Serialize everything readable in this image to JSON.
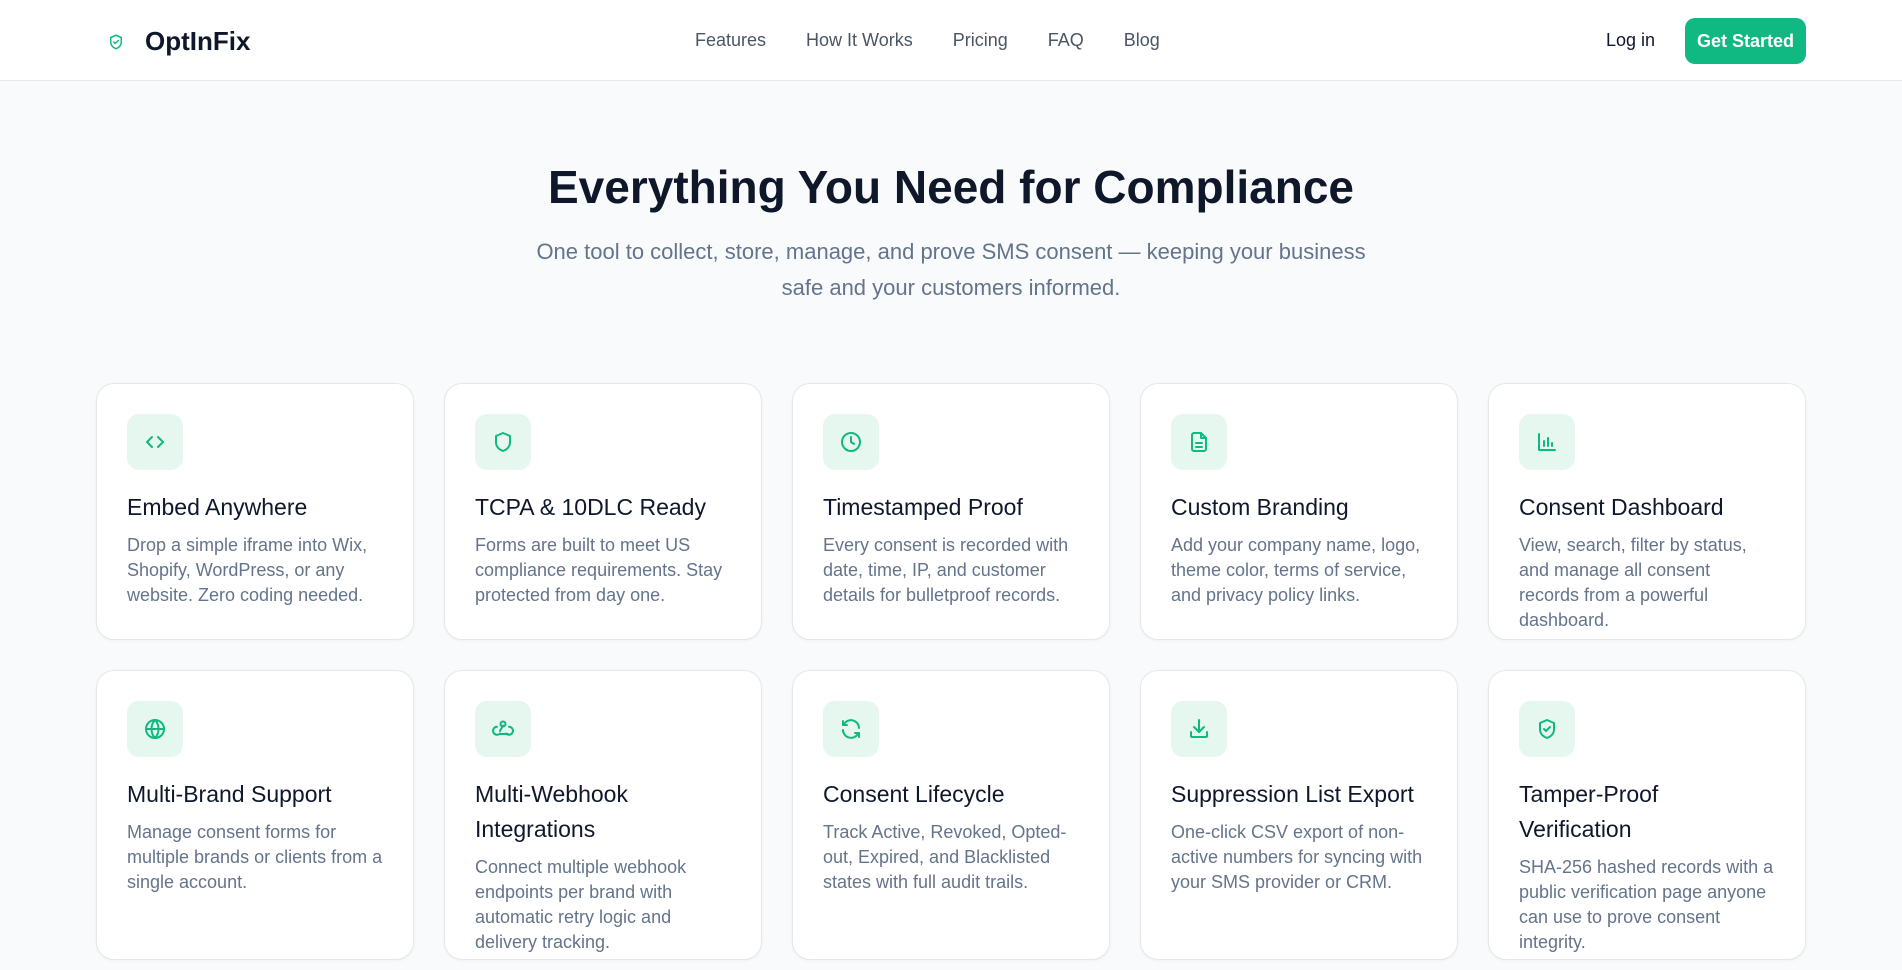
{
  "header": {
    "brand": "OptInFix",
    "nav": [
      "Features",
      "How It Works",
      "Pricing",
      "FAQ",
      "Blog"
    ],
    "login": "Log in",
    "cta": "Get Started"
  },
  "hero": {
    "title": "Everything You Need for Compliance",
    "subtitle": "One tool to collect, store, manage, and prove SMS consent — keeping your business safe and your customers informed."
  },
  "accent_color": "#10b981",
  "features": [
    {
      "icon": "code-icon",
      "title": "Embed Anywhere",
      "desc": "Drop a simple iframe into Wix, Shopify, WordPress, or any website. Zero coding needed."
    },
    {
      "icon": "shield-icon",
      "title": "TCPA & 10DLC Ready",
      "desc": "Forms are built to meet US compliance requirements. Stay protected from day one."
    },
    {
      "icon": "clock-icon",
      "title": "Timestamped Proof",
      "desc": "Every consent is recorded with date, time, IP, and customer details for bulletproof records."
    },
    {
      "icon": "document-icon",
      "title": "Custom Branding",
      "desc": "Add your company name, logo, theme color, terms of service, and privacy policy links."
    },
    {
      "icon": "bar-chart-icon",
      "title": "Consent Dashboard",
      "desc": "View, search, filter by status, and manage all consent records from a powerful dashboard."
    },
    {
      "icon": "globe-icon",
      "title": "Multi-Brand Support",
      "desc": "Manage consent forms for multiple brands or clients from a single account."
    },
    {
      "icon": "webhook-icon",
      "title": "Multi-Webhook Integrations",
      "desc": "Connect multiple webhook endpoints per brand with automatic retry logic and delivery tracking."
    },
    {
      "icon": "refresh-icon",
      "title": "Consent Lifecycle",
      "desc": "Track Active, Revoked, Opted-out, Expired, and Blacklisted states with full audit trails."
    },
    {
      "icon": "download-icon",
      "title": "Suppression List Export",
      "desc": "One-click CSV export of non-active numbers for syncing with your SMS provider or CRM."
    },
    {
      "icon": "shield-check-icon",
      "title": "Tamper-Proof Verification",
      "desc": "SHA-256 hashed records with a public verification page anyone can use to prove consent integrity."
    }
  ]
}
